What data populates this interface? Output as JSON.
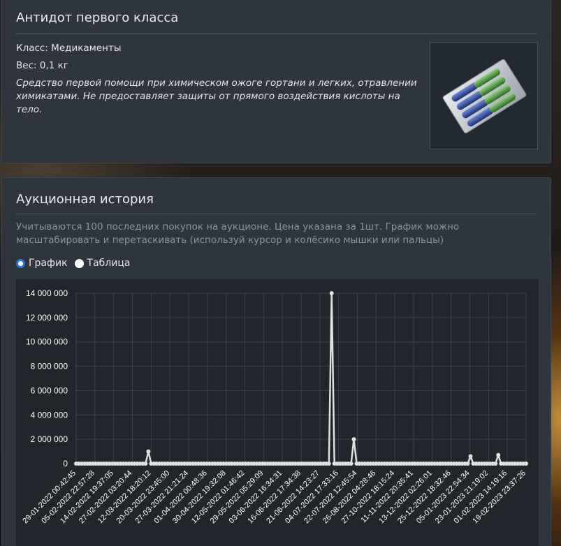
{
  "item": {
    "title": "Антидот первого класса",
    "class_text": "Класс: Медикаменты",
    "weight_text": "Вес: 0,1 кг",
    "description": "Средство первой помощи при химическом ожоге гортани и легких, отравлении химикатами. Не предоставляет защиты от прямого воздействия кислоты на тело.",
    "image_icon": "antidote-pill-blister-icon"
  },
  "auction": {
    "title": "Аукционная история",
    "note": "Учитываются 100 последних покупок на аукционе. Цена указана за 1шт. График можно масштабировать и перетаскивать (используй курсор и колёсико мышки или пальцы)",
    "view_options": [
      {
        "label": "График",
        "selected": true
      },
      {
        "label": "Таблица",
        "selected": false
      }
    ]
  },
  "colors": {
    "panel": "#2e353d",
    "chart_bg": "#21262c",
    "line": "#e0e0e0",
    "radio_accent": "#2b74e0"
  },
  "chart_data": {
    "type": "line",
    "title": "",
    "xlabel": "",
    "ylabel": "",
    "ylim": [
      0,
      14000000
    ],
    "yticks": [
      "0",
      "2 000 000",
      "4 000 000",
      "6 000 000",
      "8 000 000",
      "10 000 000",
      "12 000 000",
      "14 000 000"
    ],
    "x_tick_labels": [
      "29-01-2022 00:42:45",
      "05-02-2022 22:57:28",
      "14-02-2022 19:37:05",
      "27-02-2022 03:20:44",
      "12-03-2022 18:20:12",
      "20-03-2022 23:45:00",
      "27-03-2022 21:21:24",
      "01-04-2022 00:48:36",
      "30-04-2022 19:32:08",
      "12-05-2022 01:46:42",
      "29-05-2022 05:29:09",
      "03-06-2022 16:34:31",
      "16-06-2022 17:34:38",
      "21-06-2022 14:23:27",
      "04-07-2022 17:33:16",
      "22-07-2022 12:45:54",
      "26-08-2022 04:28:46",
      "27-10-2022 18:15:24",
      "11-11-2022 20:35:41",
      "13-12-2022 02:26:01",
      "25-12-2022 18:32:46",
      "05-01-2023 22:54:34",
      "23-01-2023 21:19:02",
      "01-02-2023 14:19:16",
      "19-02-2023 23:37:26"
    ],
    "grid": true,
    "legend": "none",
    "series": [
      {
        "values": [
          0,
          0,
          0,
          0,
          0,
          0,
          0,
          0,
          0,
          0,
          0,
          0,
          0,
          0,
          0,
          0,
          0,
          0,
          0,
          0,
          0,
          0,
          0,
          0,
          0,
          0,
          1000000,
          0,
          0,
          0,
          0,
          0,
          0,
          0,
          0,
          0,
          0,
          0,
          0,
          0,
          0,
          0,
          0,
          0,
          0,
          0,
          0,
          0,
          0,
          0,
          0,
          0,
          0,
          0,
          0,
          0,
          0,
          0,
          0,
          0,
          0,
          0,
          0,
          0,
          0,
          0,
          0,
          0,
          0,
          0,
          0,
          0,
          0,
          0,
          0,
          0,
          0,
          0,
          0,
          0,
          0,
          0,
          0,
          0,
          0,
          0,
          0,
          0,
          0,
          0,
          0,
          0,
          14000000,
          0,
          0,
          0,
          0,
          0,
          0,
          0,
          2000000,
          0,
          0,
          0,
          0,
          0,
          0,
          0,
          0,
          0,
          0,
          0,
          0,
          0,
          0,
          0,
          0,
          0,
          0,
          0,
          0,
          0,
          0,
          0,
          0,
          0,
          0,
          0,
          0,
          0,
          0,
          0,
          0,
          0,
          0,
          0,
          0,
          0,
          0,
          0,
          0,
          0,
          600000,
          0,
          0,
          0,
          0,
          0,
          0,
          0,
          0,
          0,
          700000,
          0,
          0,
          0,
          0,
          0,
          0,
          0,
          0,
          0,
          0
        ]
      }
    ]
  }
}
